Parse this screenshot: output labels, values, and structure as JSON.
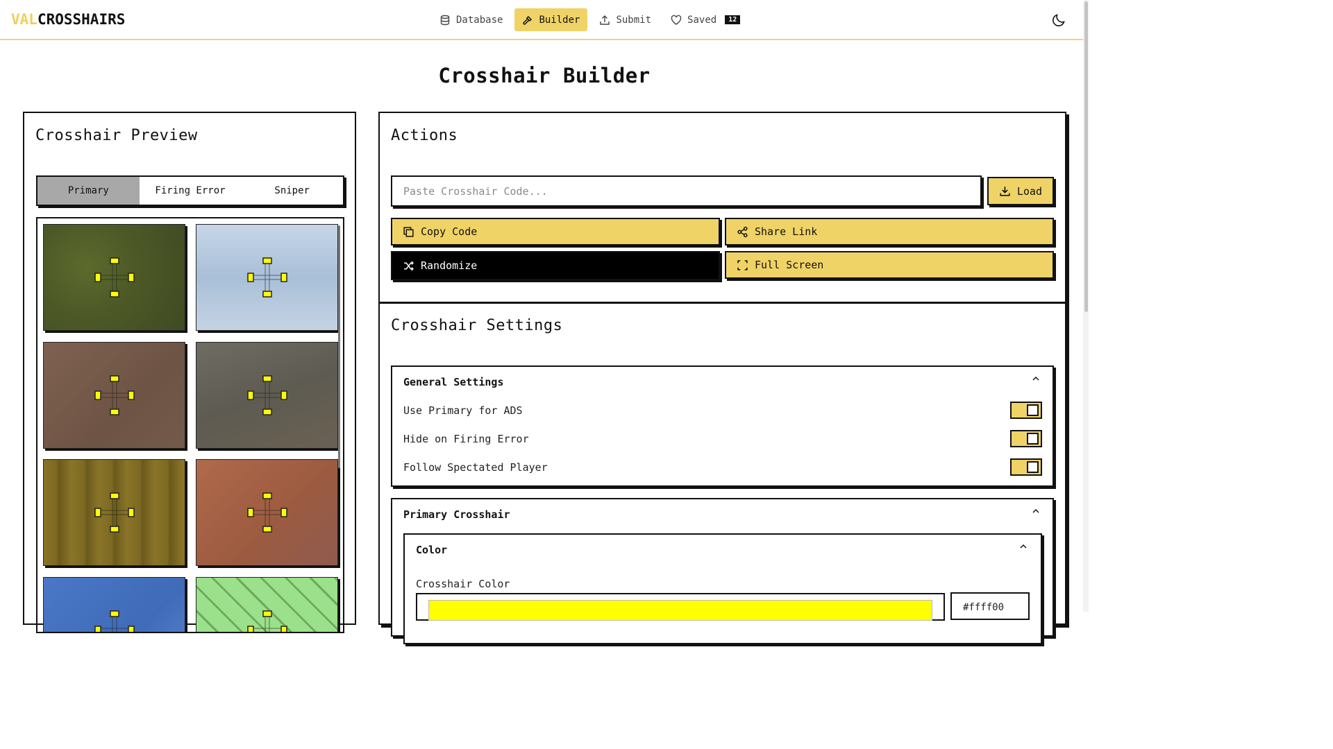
{
  "header": {
    "logo_accent": "VAL",
    "logo_main": "CROSSHAIRS",
    "nav": {
      "database": "Database",
      "builder": "Builder",
      "submit": "Submit",
      "saved": "Saved",
      "saved_count": "12"
    },
    "theme_icon": "moon-icon"
  },
  "page_title": "Crosshair Builder",
  "preview": {
    "title": "Crosshair Preview",
    "tabs": [
      "Primary",
      "Firing Error",
      "Sniper"
    ],
    "active_tab": "Primary",
    "backgrounds": [
      "grass",
      "sky",
      "clay",
      "rusted-metal",
      "wood",
      "orange-wall",
      "blue-wall",
      "green-grid"
    ]
  },
  "actions": {
    "title": "Actions",
    "code_placeholder": "Paste Crosshair Code...",
    "code_value": "",
    "load": "Load",
    "copy_code": "Copy Code",
    "share_link": "Share Link",
    "randomize": "Randomize",
    "full_screen": "Full Screen"
  },
  "settings": {
    "title": "Crosshair Settings",
    "general": {
      "title": "General Settings",
      "options": [
        {
          "label": "Use Primary for ADS",
          "on": false
        },
        {
          "label": "Hide on Firing Error",
          "on": false
        },
        {
          "label": "Follow Spectated Player",
          "on": false
        }
      ]
    },
    "primary": {
      "title": "Primary Crosshair",
      "color": {
        "title": "Color",
        "label": "Crosshair Color",
        "hex": "#ffff00"
      }
    }
  },
  "colors": {
    "accent": "#f0d366",
    "crosshair": "#ffff00",
    "border": "#111111"
  }
}
